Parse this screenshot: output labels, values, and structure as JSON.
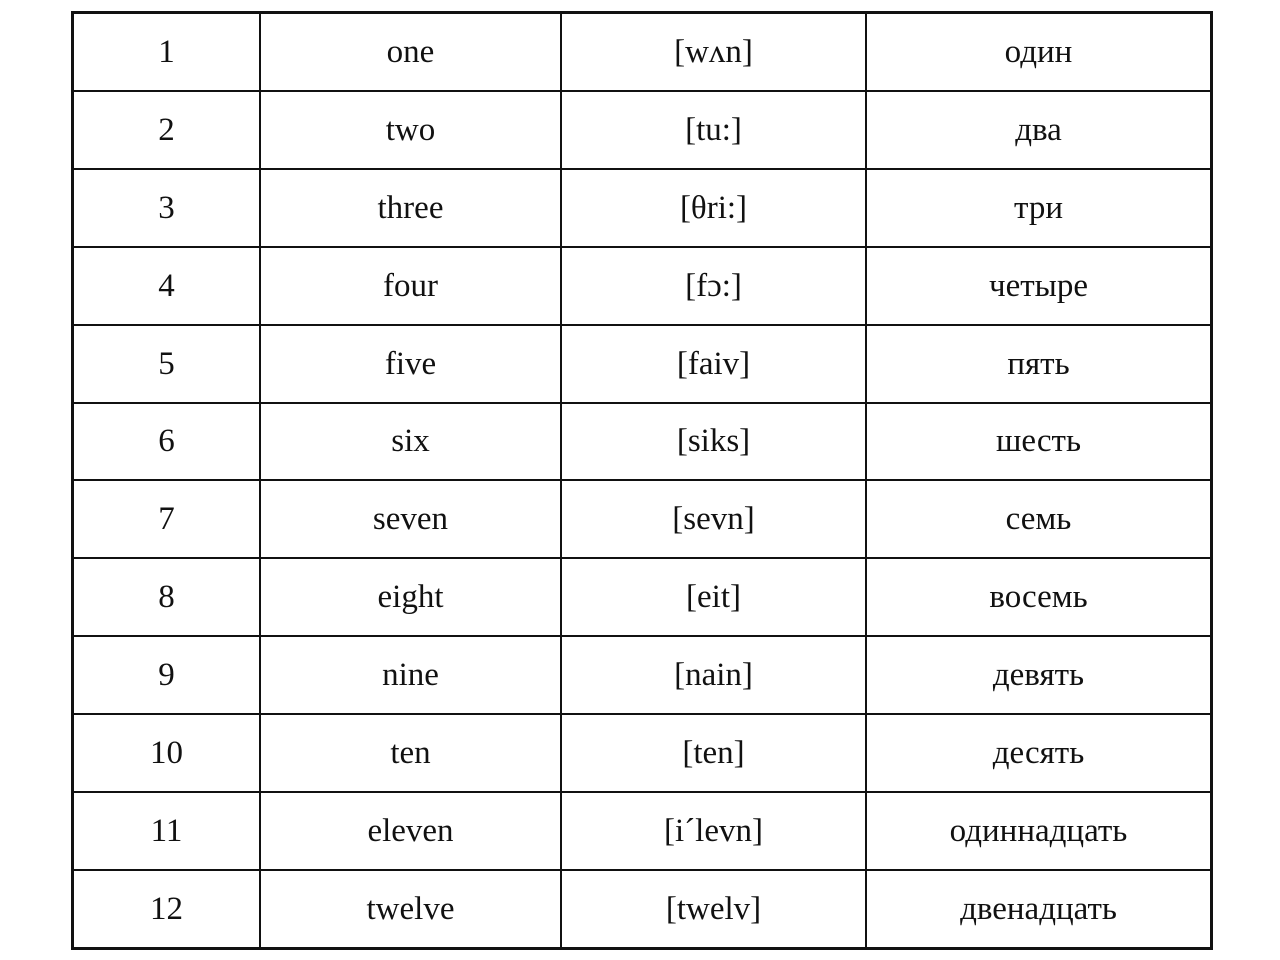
{
  "document": {
    "kind": "vocabulary-table",
    "columns": [
      "index",
      "english",
      "transcription",
      "russian"
    ],
    "background_color": "#ffffff",
    "text_color": "#111111",
    "border_color": "#111111"
  },
  "rows": [
    {
      "index": "1",
      "english": "one",
      "transcription": "[wʌn]",
      "russian": "один"
    },
    {
      "index": "2",
      "english": "two",
      "transcription": "[tu:]",
      "russian": "два"
    },
    {
      "index": "3",
      "english": "three",
      "transcription": "[θri:]",
      "russian": "три"
    },
    {
      "index": "4",
      "english": "four",
      "transcription": "[fɔ:]",
      "russian": "четыре"
    },
    {
      "index": "5",
      "english": "five",
      "transcription": "[faiv]",
      "russian": "пять"
    },
    {
      "index": "6",
      "english": "six",
      "transcription": "[siks]",
      "russian": "шесть"
    },
    {
      "index": "7",
      "english": "seven",
      "transcription": "[sevn]",
      "russian": "семь"
    },
    {
      "index": "8",
      "english": "eight",
      "transcription": "[eit]",
      "russian": "восемь"
    },
    {
      "index": "9",
      "english": "nine",
      "transcription": "[nain]",
      "russian": "девять"
    },
    {
      "index": "10",
      "english": "ten",
      "transcription": "[ten]",
      "russian": "десять"
    },
    {
      "index": "11",
      "english": "eleven",
      "transcription": "[i´levn]",
      "russian": "одиннадцать"
    },
    {
      "index": "12",
      "english": "twelve",
      "transcription": "[twelv]",
      "russian": "двенадцать"
    }
  ]
}
